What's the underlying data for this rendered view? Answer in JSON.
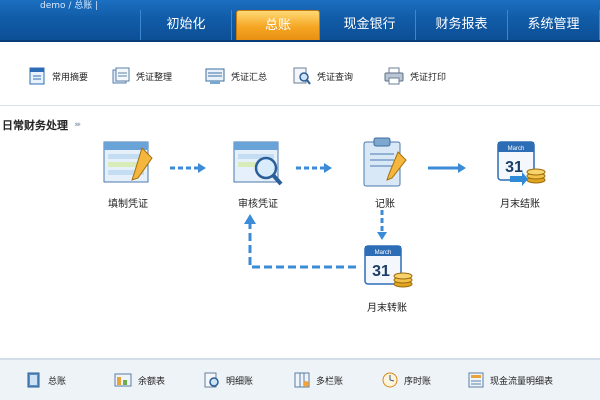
{
  "header": {
    "user_text": "demo / 总账 |",
    "tabs": [
      {
        "label": "初始化"
      },
      {
        "label": "总账"
      },
      {
        "label": "现金银行"
      },
      {
        "label": "财务报表"
      },
      {
        "label": "系统管理"
      }
    ],
    "active_tab": "总账"
  },
  "toolbar": {
    "items": [
      {
        "label": "常用摘要",
        "icon": "summary-icon"
      },
      {
        "label": "凭证整理",
        "icon": "voucher-arrange-icon"
      },
      {
        "label": "凭证汇总",
        "icon": "voucher-summary-icon"
      },
      {
        "label": "凭证查询",
        "icon": "voucher-query-icon"
      },
      {
        "label": "凭证打印",
        "icon": "voucher-print-icon"
      }
    ]
  },
  "section": {
    "title": "日常财务处理",
    "chevrons": "›››"
  },
  "flow": {
    "fill_voucher": "填制凭证",
    "review_voucher": "审核凭证",
    "posting": "记账",
    "month_end_close": "月末结账",
    "month_end_transfer": "月末转账",
    "calendar_month": "March",
    "calendar_day": "31"
  },
  "bottom": {
    "items": [
      {
        "label": "总账",
        "icon": "ledger-icon"
      },
      {
        "label": "余额表",
        "icon": "balance-icon"
      },
      {
        "label": "明细账",
        "icon": "detail-icon"
      },
      {
        "label": "多栏账",
        "icon": "multi-column-icon"
      },
      {
        "label": "序时账",
        "icon": "chronological-icon"
      },
      {
        "label": "现金流量明细表",
        "icon": "cashflow-icon"
      }
    ]
  },
  "colors": {
    "header_blue": "#115ca8",
    "active_tab": "#f5a623",
    "arrow": "#3b8bd6"
  }
}
